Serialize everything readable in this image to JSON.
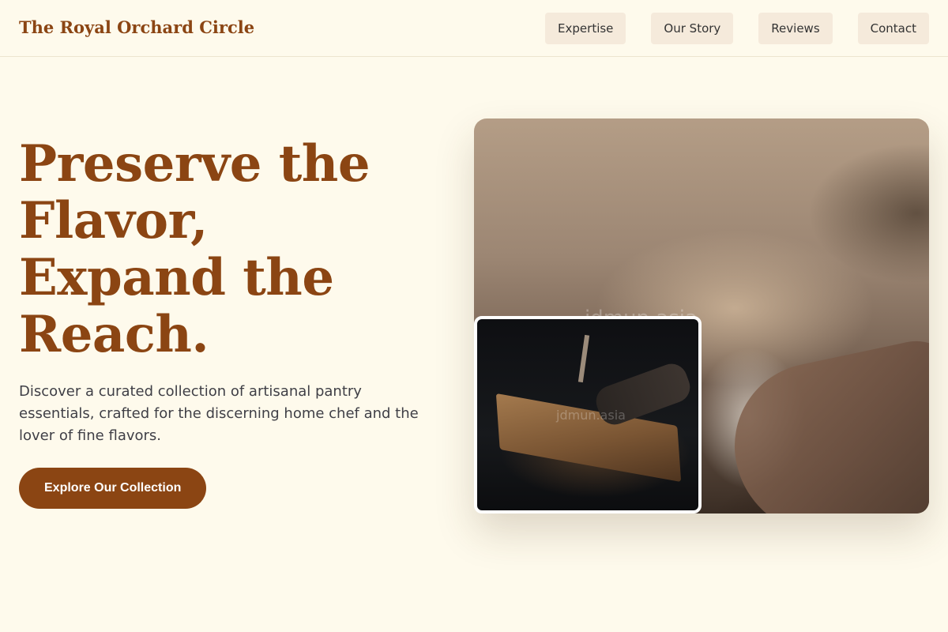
{
  "brand": {
    "name": "The Royal Orchard Circle"
  },
  "nav": {
    "items": [
      {
        "label": "Expertise"
      },
      {
        "label": "Our Story"
      },
      {
        "label": "Reviews"
      },
      {
        "label": "Contact"
      }
    ]
  },
  "hero": {
    "title_lines": [
      "Preserve the",
      "Flavor,",
      "Expand the",
      "Reach."
    ],
    "description": "Discover a curated collection of artisanal pantry essentials, crafted for the discerning home chef and the lover of fine flavors.",
    "cta_label": "Explore Our Collection"
  },
  "images": {
    "main_watermark": "jdmun.asia",
    "inset_watermark": "jdmun.asia"
  },
  "colors": {
    "background": "#fefaec",
    "accent": "#8b4513",
    "nav_button_bg": "#f5eadb",
    "body_text": "#3f3f46"
  }
}
